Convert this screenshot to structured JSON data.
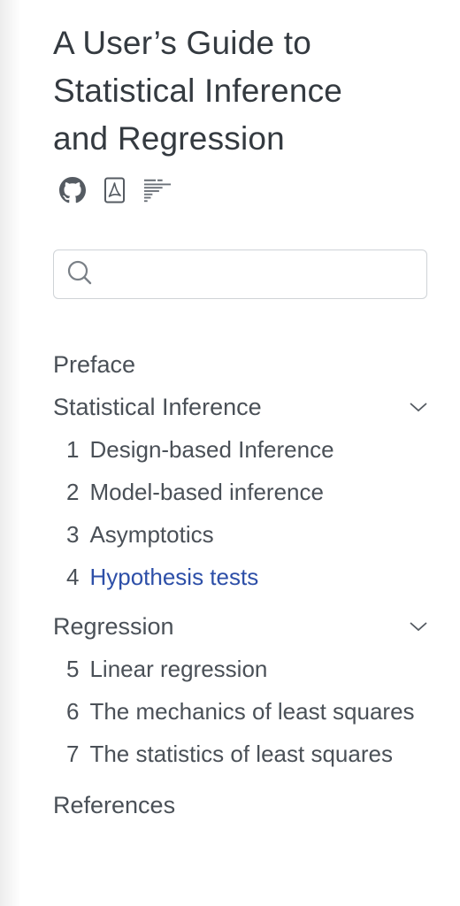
{
  "book": {
    "title_lines": [
      "A User’s Guide to",
      "Statistical Inference",
      "and Regression"
    ]
  },
  "tools": [
    {
      "icon": "github-icon"
    },
    {
      "icon": "pdf-icon"
    },
    {
      "icon": "toc-icon"
    }
  ],
  "search": {
    "value": "",
    "placeholder": ""
  },
  "nav": {
    "preface": "Preface",
    "sections": [
      {
        "title": "Statistical Inference",
        "chapters": [
          {
            "num": "1",
            "label": "Design-based Inference"
          },
          {
            "num": "2",
            "label": "Model-based inference"
          },
          {
            "num": "3",
            "label": "Asymptotics"
          },
          {
            "num": "4",
            "label": "Hypothesis tests"
          }
        ]
      },
      {
        "title": "Regression",
        "chapters": [
          {
            "num": "5",
            "label": "Linear regression"
          },
          {
            "num": "6",
            "label": "The mechanics of least squares"
          },
          {
            "num": "7",
            "label": "The statistics of least squares"
          }
        ]
      }
    ],
    "references": "References"
  },
  "colors": {
    "text": "#4a5057",
    "active": "#2d4fa8",
    "border": "#cfd3d7"
  }
}
